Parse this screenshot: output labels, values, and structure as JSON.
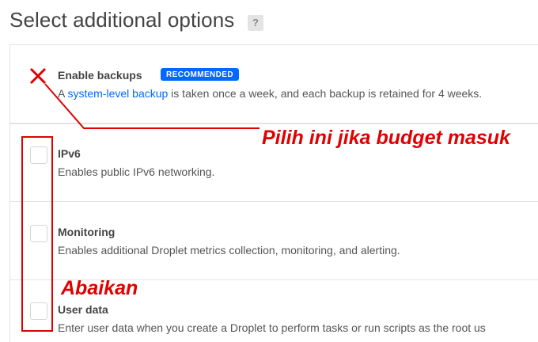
{
  "section": {
    "title": "Select additional options",
    "help_label": "?"
  },
  "options": [
    {
      "label": "Enable backups",
      "badge": "RECOMMENDED",
      "desc_prefix": "A ",
      "desc_link": "system-level backup",
      "desc_suffix": " is taken once a week, and each backup is retained for 4 weeks.",
      "checked": true
    },
    {
      "label": "IPv6",
      "desc": "Enables public IPv6 networking.",
      "checked": false
    },
    {
      "label": "Monitoring",
      "desc": "Enables additional Droplet metrics collection, monitoring, and alerting.",
      "checked": false
    },
    {
      "label": "User data",
      "desc": "Enter user data when you create a Droplet to perform tasks or run scripts as the root us",
      "checked": false
    }
  ],
  "annotations": {
    "backup_note": "Pilih ini jika budget masuk",
    "ignore_note": "Abaikan",
    "color": "#e00000"
  },
  "colors": {
    "accent": "#0069ff",
    "text": "#444444",
    "border": "#e4e4e4"
  }
}
